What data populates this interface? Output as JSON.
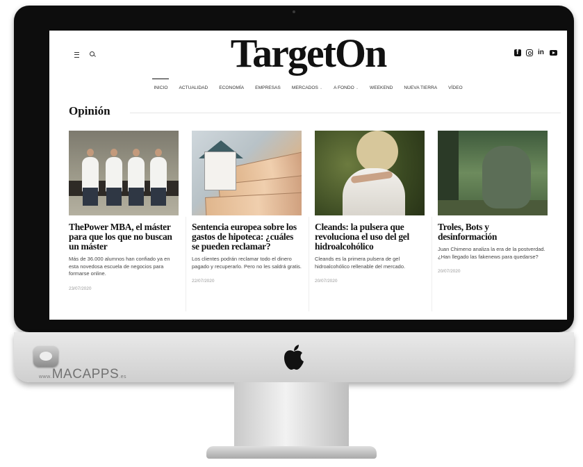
{
  "site": {
    "logo": "TargetOn"
  },
  "nav": {
    "items": [
      {
        "label": "INICIO",
        "active": true,
        "has_dropdown": false
      },
      {
        "label": "ACTUALIDAD",
        "active": false,
        "has_dropdown": false
      },
      {
        "label": "ECONOMÍA",
        "active": false,
        "has_dropdown": false
      },
      {
        "label": "EMPRESAS",
        "active": false,
        "has_dropdown": false
      },
      {
        "label": "MERCADOS",
        "active": false,
        "has_dropdown": true
      },
      {
        "label": "A FONDO",
        "active": false,
        "has_dropdown": true
      },
      {
        "label": "WEEKEND",
        "active": false,
        "has_dropdown": false
      },
      {
        "label": "NUEVA TIERRA",
        "active": false,
        "has_dropdown": false
      },
      {
        "label": "VÍDEO",
        "active": false,
        "has_dropdown": false
      }
    ]
  },
  "social": {
    "icons": [
      "facebook-icon",
      "instagram-icon",
      "linkedin-icon",
      "youtube-icon"
    ],
    "linkedin_text": "in"
  },
  "section": {
    "title": "Opinión"
  },
  "articles": [
    {
      "image": "four-men-on-bench",
      "title": "ThePower MBA, el máster para que los que no buscan un máster",
      "excerpt": "Más de 36.000 alumnos han confiado ya en esta novedosa escuela de negocios para formarse online.",
      "date": "23/07/2020"
    },
    {
      "image": "house-on-euro-bills",
      "title": "Sentencia europea sobre los gastos de hipoteca: ¿cuáles se pueden reclamar?",
      "excerpt": "Los clientes podrán reclamar todo el dinero pagado y recuperarlo. Pero no les saldrá gratis.",
      "date": "22/07/2020"
    },
    {
      "image": "woman-hands-bracelet",
      "title": "Cleands: la pulsera que revoluciona el uso del gel hidroalcohólico",
      "excerpt": "Cleands es la primera pulsera de gel hidroalcohólico rellenable del mercado.",
      "date": "20/07/2020"
    },
    {
      "image": "troll-in-forest",
      "title": "Troles, Bots y desinformación",
      "excerpt": "Juan Chimeno analiza la era de la postverdad. ¿Han llegado las fakenews para quedarse?",
      "date": "20/07/2020"
    }
  ],
  "watermark": {
    "prefix": "www.",
    "brand": "MACAPPS",
    "suffix": ".es"
  },
  "colors": {
    "bezel": "#0d0d0d",
    "chin": "#dcdcdc",
    "text": "#111111",
    "muted": "#999999"
  }
}
